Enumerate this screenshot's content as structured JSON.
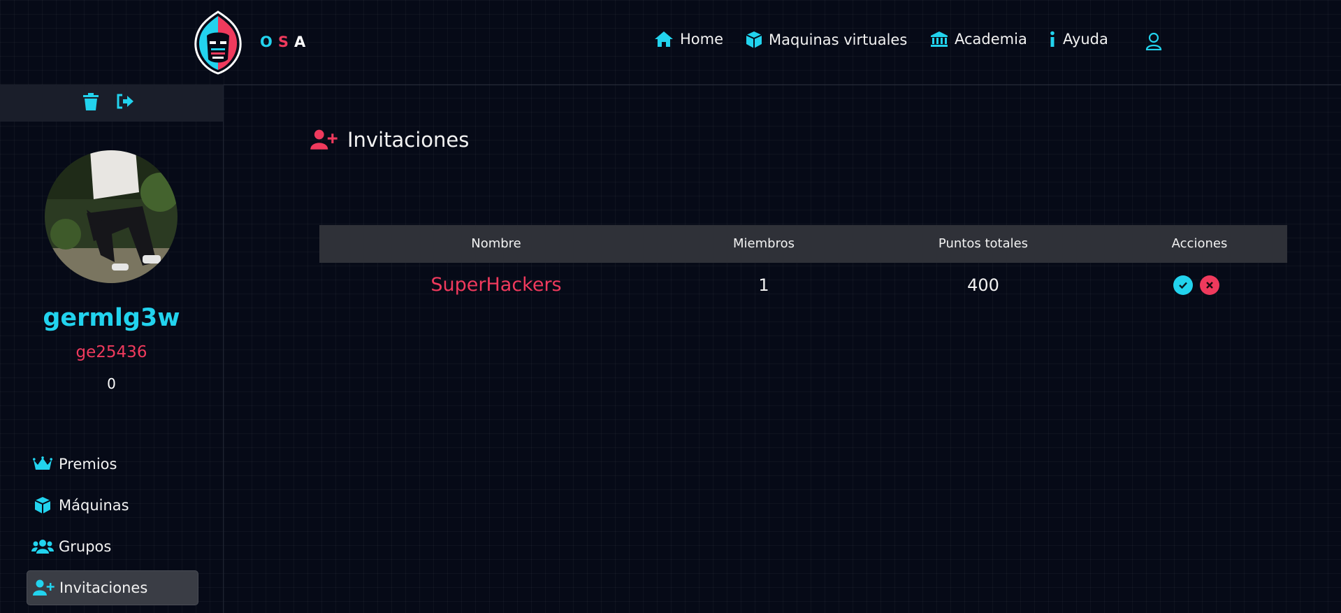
{
  "brand": {
    "letters": [
      "O",
      "S",
      "A"
    ]
  },
  "nav": {
    "home": "Home",
    "vms": "Maquinas virtuales",
    "academy": "Academia",
    "help": "Ayuda"
  },
  "profile": {
    "username": "germlg3w",
    "code": "ge25436",
    "points": "0"
  },
  "sidebar": {
    "items": [
      {
        "label": "Premios",
        "icon": "crown-icon"
      },
      {
        "label": "Máquinas",
        "icon": "cube-icon"
      },
      {
        "label": "Grupos",
        "icon": "users-icon"
      },
      {
        "label": "Invitaciones",
        "icon": "user-plus-icon",
        "active": true
      }
    ]
  },
  "main": {
    "title": "Invitaciones",
    "table": {
      "headers": [
        "Nombre",
        "Miembros",
        "Puntos totales",
        "Acciones"
      ],
      "rows": [
        {
          "name": "SuperHackers",
          "members": "1",
          "points": "400"
        }
      ]
    }
  },
  "colors": {
    "cyan": "#22d3ee",
    "red": "#ef3a5d",
    "background": "#060a17"
  }
}
